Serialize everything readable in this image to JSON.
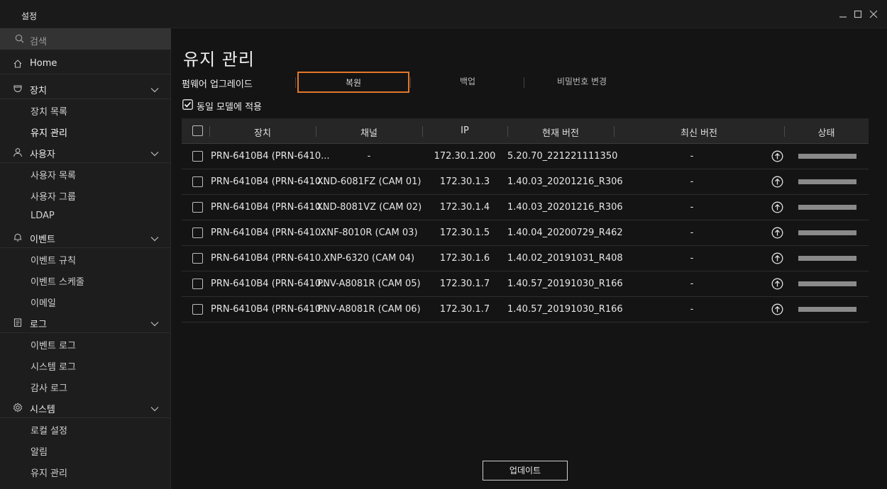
{
  "window": {
    "title": "설정"
  },
  "sidebar": {
    "search_placeholder": "검색",
    "sections": [
      {
        "label": "Home",
        "icon": "home-icon",
        "items": []
      },
      {
        "label": "장치",
        "icon": "camera-icon",
        "items": [
          "장치 목록",
          "유지 관리"
        ]
      },
      {
        "label": "사용자",
        "icon": "user-icon",
        "items": [
          "사용자 목록",
          "사용자 그룹",
          "LDAP"
        ]
      },
      {
        "label": "이벤트",
        "icon": "bell-icon",
        "items": [
          "이벤트 규칙",
          "이벤트 스케줄",
          "이메일"
        ]
      },
      {
        "label": "로그",
        "icon": "log-icon",
        "items": [
          "이벤트 로그",
          "시스템 로그",
          "감사 로그"
        ]
      },
      {
        "label": "시스템",
        "icon": "gear-icon",
        "items": [
          "로컬 설정",
          "알림",
          "유지 관리"
        ]
      }
    ],
    "active_item": "유지 관리"
  },
  "main": {
    "title": "유지 관리",
    "section_label": "펌웨어 업그레이드",
    "tabs": [
      "복원",
      "백업",
      "비밀번호 변경"
    ],
    "selected_tab": 0,
    "apply_same_model": {
      "label": "동일 모델에 적용",
      "checked": true
    },
    "table": {
      "headers": [
        "장치",
        "채널",
        "IP",
        "현재 버전",
        "최신 버전",
        "상태"
      ],
      "rows": [
        {
          "device": "PRN-6410B4 (PRN-6410...",
          "channel": "-",
          "ip": "172.30.1.200",
          "current": "5.20.70_221221111350",
          "latest": "-"
        },
        {
          "device": "PRN-6410B4 (PRN-6410...",
          "channel": "XND-6081FZ (CAM 01)",
          "ip": "172.30.1.3",
          "current": "1.40.03_20201216_R306",
          "latest": "-"
        },
        {
          "device": "PRN-6410B4 (PRN-6410...",
          "channel": "XND-8081VZ (CAM 02)",
          "ip": "172.30.1.4",
          "current": "1.40.03_20201216_R306",
          "latest": "-"
        },
        {
          "device": "PRN-6410B4 (PRN-6410...",
          "channel": "XNF-8010R (CAM 03)",
          "ip": "172.30.1.5",
          "current": "1.40.04_20200729_R462",
          "latest": "-"
        },
        {
          "device": "PRN-6410B4 (PRN-6410...",
          "channel": "XNP-6320 (CAM 04)",
          "ip": "172.30.1.6",
          "current": "1.40.02_20191031_R408",
          "latest": "-"
        },
        {
          "device": "PRN-6410B4 (PRN-6410...",
          "channel": "PNV-A8081R (CAM 05)",
          "ip": "172.30.1.7",
          "current": "1.40.57_20191030_R166",
          "latest": "-"
        },
        {
          "device": "PRN-6410B4 (PRN-6410...",
          "channel": "PNV-A8081R (CAM 06)",
          "ip": "172.30.1.7",
          "current": "1.40.57_20191030_R166",
          "latest": "-"
        }
      ]
    },
    "update_button": "업데이트"
  },
  "colors": {
    "accent": "#e3772b",
    "background": "#141414",
    "sidebar": "#1d1d1d"
  }
}
